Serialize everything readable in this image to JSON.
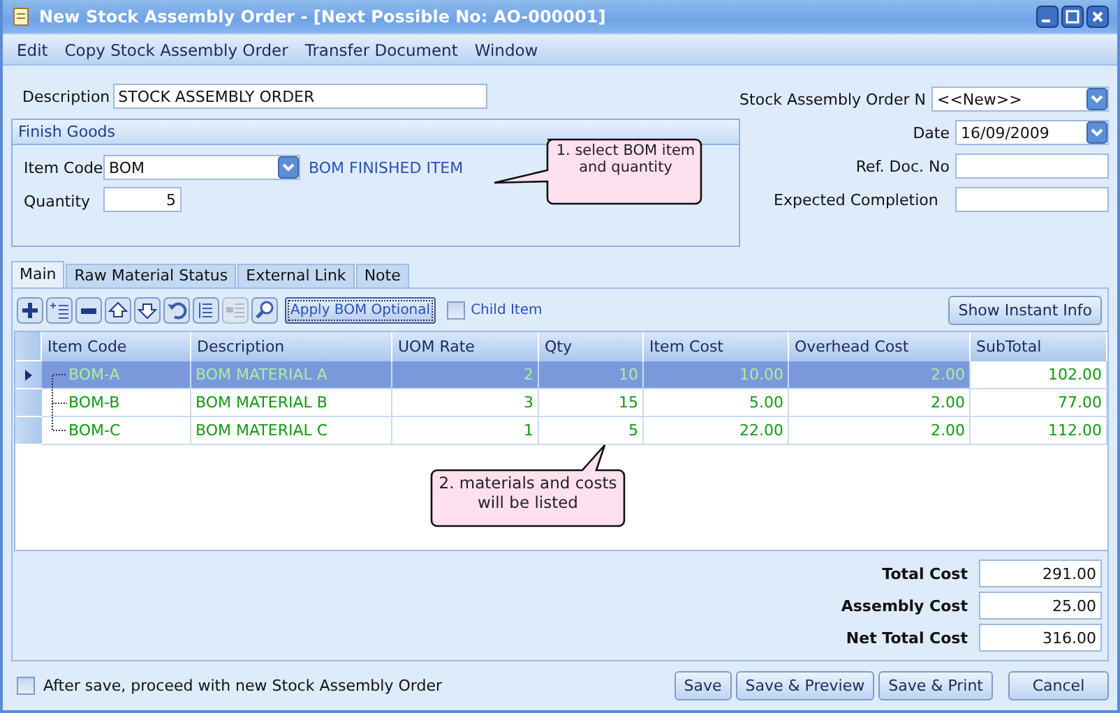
{
  "window": {
    "title": "New Stock Assembly Order  - [Next Possible No: AO-000001]"
  },
  "menu": [
    "Edit",
    "Copy Stock Assembly Order",
    "Transfer Document",
    "Window"
  ],
  "description": {
    "label": "Description",
    "value": "STOCK ASSEMBLY ORDER"
  },
  "finish_goods": {
    "title": "Finish Goods",
    "item_code": {
      "label": "Item Code",
      "value": "BOM",
      "name": "BOM FINISHED ITEM"
    },
    "quantity": {
      "label": "Quantity",
      "value": "5"
    }
  },
  "header_fields": [
    {
      "kind": "dropdown",
      "label": "Stock Assembly Order N",
      "value": "<<New>>"
    },
    {
      "kind": "date",
      "label": "Date",
      "value": "16/09/2009"
    },
    {
      "kind": "text",
      "label": "Ref. Doc. No"
    },
    {
      "kind": "text",
      "label": "Expected Completion"
    }
  ],
  "callouts": [
    {
      "text": "1. select BOM item and quantity"
    },
    {
      "text": "2. materials and costs will be listed"
    }
  ],
  "tabs": [
    {
      "label": "Main",
      "selected": true
    },
    {
      "label": "Raw Material Status",
      "selected": false
    },
    {
      "label": "External Link",
      "selected": false
    },
    {
      "label": "Note",
      "selected": false
    }
  ],
  "toolbar": {
    "tools": [
      {
        "kind": "add"
      },
      {
        "kind": "insert"
      },
      {
        "kind": "remove"
      },
      {
        "kind": "up"
      },
      {
        "kind": "down"
      },
      {
        "kind": "undo"
      },
      {
        "kind": "list"
      },
      {
        "kind": "list_disabled"
      },
      {
        "kind": "search"
      }
    ],
    "apply_button": "Apply BOM Optional",
    "child_item": {
      "label": "Child Item",
      "checked": false
    },
    "info_button": "Show Instant Info"
  },
  "table": {
    "columns": [
      "Item Code",
      "Description",
      "UOM Rate",
      "Qty",
      "Item Cost",
      "Overhead Cost",
      "SubTotal"
    ],
    "rows": [
      {
        "selected": true,
        "cells": [
          "BOM-A",
          "BOM MATERIAL A",
          "2",
          "10",
          "10.00",
          "2.00",
          "102.00"
        ]
      },
      {
        "selected": false,
        "cells": [
          "BOM-B",
          "BOM MATERIAL B",
          "3",
          "15",
          "5.00",
          "2.00",
          "77.00"
        ]
      },
      {
        "selected": false,
        "cells": [
          "BOM-C",
          "BOM MATERIAL C",
          "1",
          "5",
          "22.00",
          "2.00",
          "112.00"
        ]
      }
    ]
  },
  "totals": [
    {
      "label": "Total Cost",
      "value": "291.00"
    },
    {
      "label": "Assembly Cost",
      "value": "25.00"
    },
    {
      "label": "Net Total Cost",
      "value": "316.00"
    }
  ],
  "footer": {
    "proceed": {
      "label": "After save, proceed with new Stock Assembly Order",
      "checked": false
    },
    "buttons": [
      "Save",
      "Save & Preview",
      "Save & Print",
      "Cancel"
    ]
  }
}
